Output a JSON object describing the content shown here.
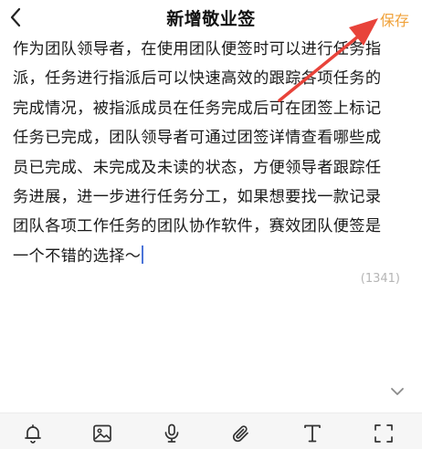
{
  "header": {
    "back_icon": "chevron-left-icon",
    "title": "新增敬业签",
    "save_label": "保存"
  },
  "editor": {
    "lines": [
      "作为团队领导者，在使用团队便签时可以进行任务指",
      "派，任务进行指派后可以快速高效的跟踪各项任务的",
      "完成情况，被指派成员在任务完成后可在团签上标记",
      "任务已完成，团队领导者可通过团签详情查看哪些成",
      "员已完成、未完成及未读的状态，方便领导者跟踪任",
      "务进展，进一步进行任务分工，如果想要找一款记录",
      "团队各项工作任务的团队协作软件，赛效团队便签是",
      "一个不错的选择～"
    ],
    "char_count": "(1341)"
  },
  "collapse_icon": "chevron-down-icon",
  "toolbar": {
    "tools": [
      {
        "name": "reminder",
        "icon": "bell-icon"
      },
      {
        "name": "image",
        "icon": "image-icon"
      },
      {
        "name": "voice",
        "icon": "microphone-icon"
      },
      {
        "name": "attachment",
        "icon": "paperclip-icon"
      },
      {
        "name": "text-format",
        "icon": "text-format-icon"
      },
      {
        "name": "fullscreen",
        "icon": "fullscreen-icon"
      }
    ]
  },
  "colors": {
    "accent": "#f0a23a",
    "annotation_arrow": "#e8433a",
    "caret": "#4b74d8",
    "toolbar_bg": "#f6f6f6"
  }
}
